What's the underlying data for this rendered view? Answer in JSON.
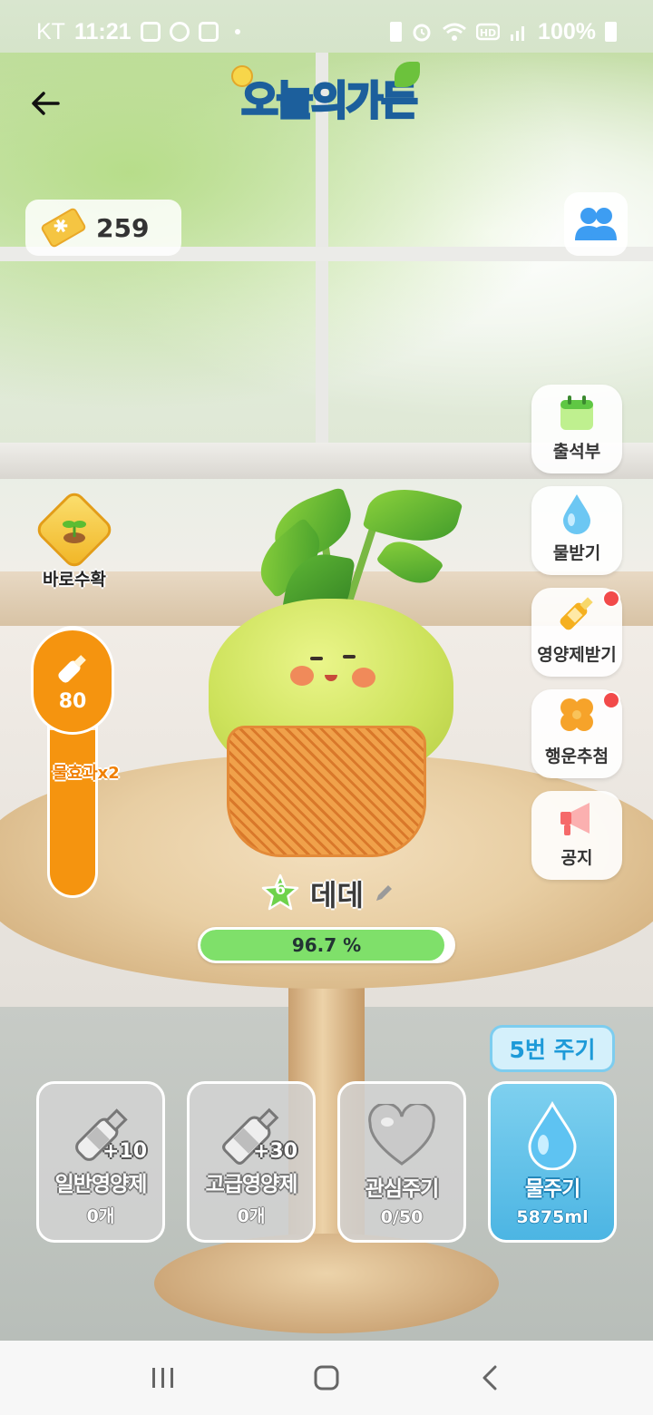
{
  "status_bar": {
    "carrier": "KT",
    "time": "11:21",
    "battery": "100%",
    "icons": [
      "gallery-icon",
      "cloud-icon",
      "instagram-icon",
      "dot-icon",
      "battery-saver-icon",
      "alarm-icon",
      "wifi-icon",
      "hd-icon",
      "signal-icon",
      "battery-icon"
    ]
  },
  "header": {
    "logo_text": "오늘의가든",
    "back_icon": "arrow-left-icon"
  },
  "currency": {
    "amount": "259",
    "icon": "ticket-icon"
  },
  "friends_button": {
    "icon": "friends-icon"
  },
  "side_menu": [
    {
      "label": "출석부",
      "icon": "calendar-icon",
      "badge": false
    },
    {
      "label": "물받기",
      "icon": "water-drop-icon",
      "badge": false
    },
    {
      "label": "영양제받기",
      "icon": "nutrient-bottle-icon",
      "badge": true
    },
    {
      "label": "행운추첨",
      "icon": "clover-icon",
      "badge": true
    },
    {
      "label": "공지",
      "icon": "megaphone-icon",
      "badge": false
    }
  ],
  "harvest": {
    "label": "바로수확",
    "icon": "sprout-icon"
  },
  "water_gauge": {
    "value": "80",
    "effect_label": "물효과x2",
    "level_fraction": 0.62,
    "icon": "bottle-icon"
  },
  "plant": {
    "level": "6",
    "name": "데데",
    "edit_icon": "pencil-icon",
    "progress_text": "96.7 %",
    "progress_value": 96.7
  },
  "actions": {
    "remaining_label": "5번 주기",
    "cards": [
      {
        "label": "일반영양제",
        "sub": "0개",
        "bonus": "+10",
        "icon": "nutrient-bottle-icon",
        "active": false
      },
      {
        "label": "고급영양제",
        "sub": "0개",
        "bonus": "+30",
        "icon": "premium-nutrient-icon",
        "active": false
      },
      {
        "label": "관심주기",
        "sub": "0/50",
        "bonus": "",
        "icon": "heart-icon",
        "active": false
      },
      {
        "label": "물주기",
        "sub": "5875ml",
        "bonus": "",
        "icon": "water-drop-icon",
        "active": true
      }
    ]
  },
  "colors": {
    "accent_orange": "#f5940f",
    "accent_blue": "#4cb5e3",
    "progress_green": "#7fe06a",
    "badge_red": "#f24a4a"
  },
  "nav_bar": [
    "recents-icon",
    "home-icon",
    "back-icon"
  ]
}
